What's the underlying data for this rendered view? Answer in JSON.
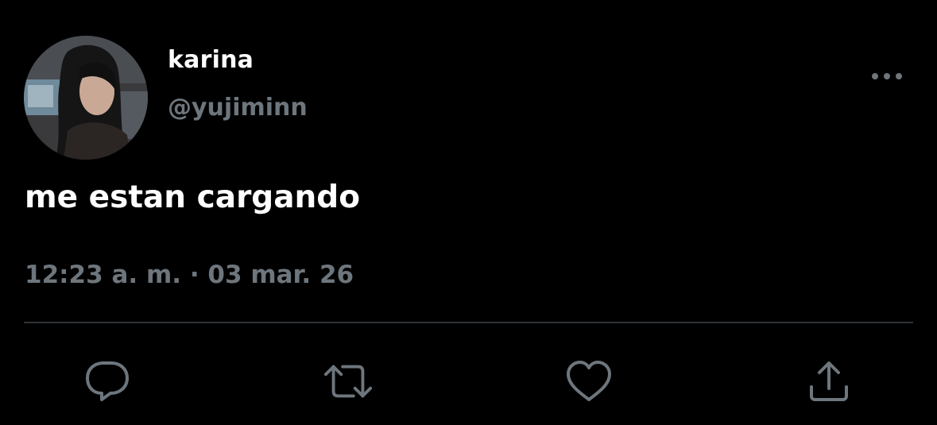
{
  "tweet": {
    "author": {
      "display_name": "karina",
      "handle": "@yujiminn"
    },
    "text": "me estan cargando",
    "timestamp": "12:23 a. m. · 03 mar. 26"
  },
  "icons": {
    "more": "more-horizontal-icon",
    "reply": "reply-icon",
    "retweet": "retweet-icon",
    "like": "heart-icon",
    "share": "share-icon"
  },
  "colors": {
    "background": "#000000",
    "primary_text": "#ffffff",
    "secondary_text": "#6e767d",
    "divider": "#2f3336"
  }
}
